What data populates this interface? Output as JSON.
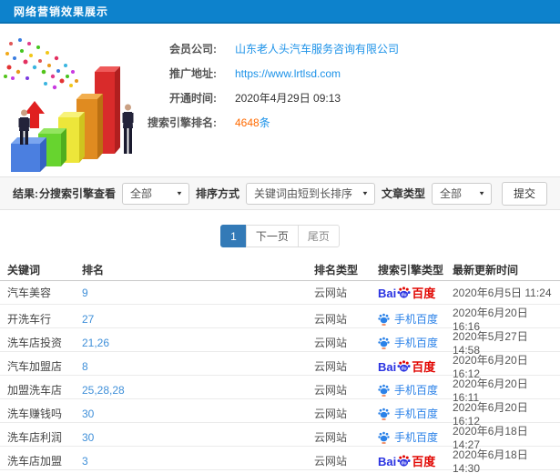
{
  "header": {
    "title": "网络营销效果展示"
  },
  "info": {
    "rows": [
      {
        "label": "会员公司:",
        "value": "山东老人头汽车服务咨询有限公司"
      },
      {
        "label": "推广地址:",
        "value": "https://www.lrtlsd.com"
      },
      {
        "label": "开通时间:",
        "value": "2020年4月29日 09:13"
      },
      {
        "label": "搜索引擎排名:",
        "value": "4648",
        "unit": "条"
      }
    ]
  },
  "filters": {
    "result_label": "结果:",
    "engine_filter": {
      "label": "分搜索引擎查看",
      "value": "全部"
    },
    "sort_filter": {
      "label": "排序方式",
      "value": "关键词由短到长排序"
    },
    "article_filter": {
      "label": "文章类型",
      "value": "全部"
    },
    "submit_label": "提交"
  },
  "pagination": {
    "current": "1",
    "next_label": "下一页",
    "last_label": "尾页"
  },
  "table": {
    "headers": [
      "关键词",
      "排名",
      "排名类型",
      "搜索引擎类型",
      "最新更新时间"
    ],
    "rows": [
      {
        "keyword": "汽车美容",
        "rank": "9",
        "rank_type": "云网站",
        "engine": "baidu-pc",
        "updated": "2020年6月5日 11:24"
      },
      {
        "keyword": "开洗车行",
        "rank": "27",
        "rank_type": "云网站",
        "engine": "baidu-mobile",
        "updated": "2020年6月20日 16:16"
      },
      {
        "keyword": "洗车店投资",
        "rank": "21,26",
        "rank_type": "云网站",
        "engine": "baidu-mobile",
        "updated": "2020年5月27日 14:58"
      },
      {
        "keyword": "汽车加盟店",
        "rank": "8",
        "rank_type": "云网站",
        "engine": "baidu-pc",
        "updated": "2020年6月20日 16:12"
      },
      {
        "keyword": "加盟洗车店",
        "rank": "25,28,28",
        "rank_type": "云网站",
        "engine": "baidu-mobile",
        "updated": "2020年6月20日 16:11"
      },
      {
        "keyword": "洗车赚钱吗",
        "rank": "30",
        "rank_type": "云网站",
        "engine": "baidu-mobile",
        "updated": "2020年6月20日 16:12"
      },
      {
        "keyword": "洗车店利润",
        "rank": "30",
        "rank_type": "云网站",
        "engine": "baidu-mobile",
        "updated": "2020年6月18日 14:27"
      },
      {
        "keyword": "洗车店加盟",
        "rank": "3",
        "rank_type": "云网站",
        "engine": "baidu-pc",
        "updated": "2020年6月18日 14:30"
      }
    ]
  },
  "engine": {
    "pc_bai": "Bai",
    "pc_du_inner": "du",
    "pc_name": "百度",
    "mobile_name": "手机百度"
  },
  "colors": {
    "topbar": "#0d82cc",
    "link_blue": "#1c92e8",
    "rank_blue": "#4090d9",
    "highlight_orange": "#ff6a00",
    "active_page": "#337ab7",
    "baidu_blue": "#2932e1",
    "baidu_red": "#e10602",
    "mobile_blue": "#2b82e8"
  }
}
